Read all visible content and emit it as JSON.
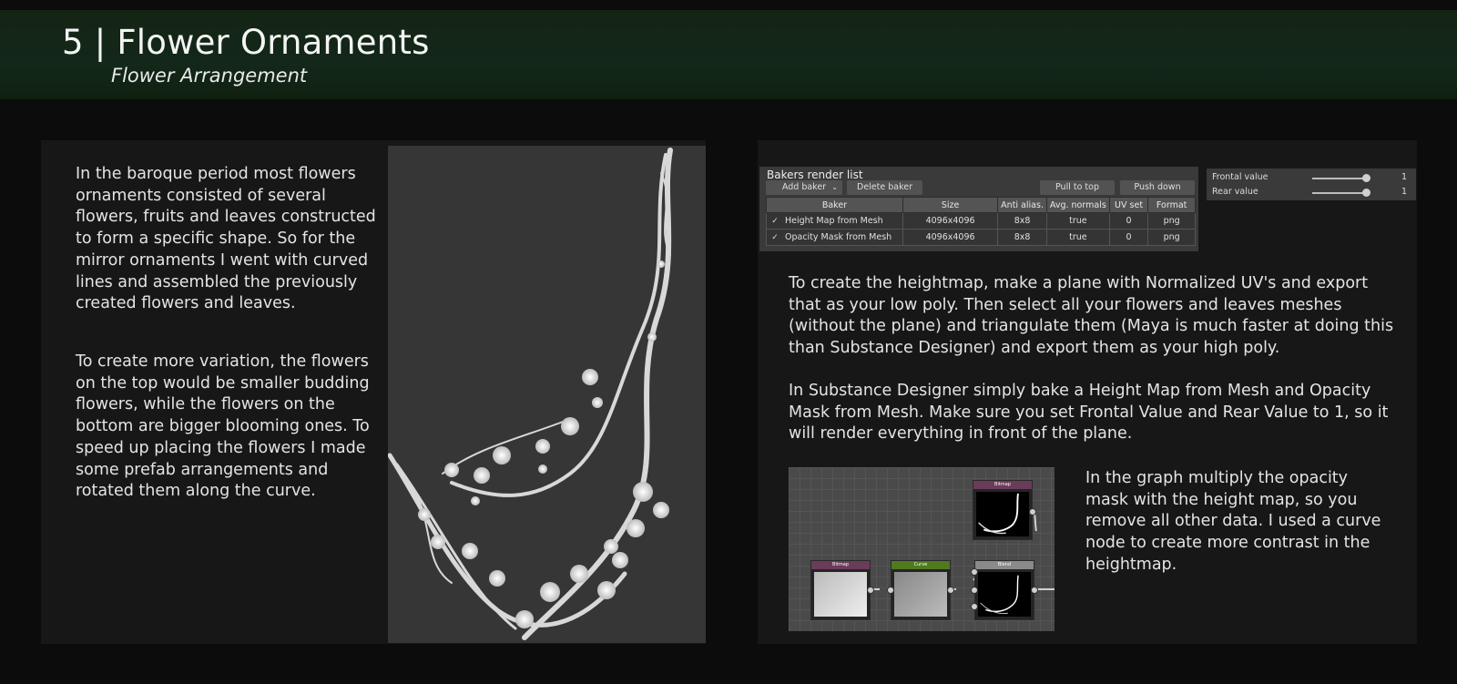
{
  "header": {
    "title": "5 | Flower Ornaments",
    "subtitle": "Flower Arrangement"
  },
  "left": {
    "paragraph1": "In the baroque period most flowers ornaments consisted of several flowers, fruits and leaves constructed to form a specific shape. So for the mirror ornaments I went with curved lines and assembled the previously created flowers and leaves.",
    "paragraph2": "To create more variation, the flowers on the top would be smaller budding flowers, while the flowers on the bottom are bigger blooming ones. To speed up placing the flowers I made some prefab arrangements and rotated them along the curve."
  },
  "bakers": {
    "title": "Bakers render list",
    "add_label": "Add baker",
    "delete_label": "Delete baker",
    "pull_label": "Pull to top",
    "push_label": "Push down",
    "columns": [
      "Baker",
      "Size",
      "Anti alias.",
      "Avg. normals",
      "UV set",
      "Format"
    ],
    "rows": [
      {
        "name": "Height Map from Mesh",
        "size": "4096x4096",
        "aa": "8x8",
        "avg": "true",
        "uv": "0",
        "format": "png"
      },
      {
        "name": "Opacity Mask from Mesh",
        "size": "4096x4096",
        "aa": "8x8",
        "avg": "true",
        "uv": "0",
        "format": "png"
      }
    ]
  },
  "values": {
    "frontal_label": "Frontal value",
    "frontal_value": "1",
    "rear_label": "Rear value",
    "rear_value": "1"
  },
  "right": {
    "paragraph1": "To create the heightmap, make a plane with Normalized UV's and export that as your low poly. Then select all your flowers and leaves meshes (without the plane) and triangulate them (Maya is much faster at doing this than Substance Designer) and export them as your high poly.",
    "paragraph2": "In Substance Designer simply bake a Height Map from Mesh and Opacity Mask from Mesh. Make sure you set Frontal Value and Rear Value to 1, so it will render everything in front of the plane.",
    "paragraph3": "In the graph multiply the opacity mask with the height map, so you remove all other data. I used a curve node to create more contrast in the heightmap."
  },
  "graph": {
    "nodes": {
      "bitmap_top": "Bitmap",
      "bitmap_left": "Bitmap",
      "curve": "Curve",
      "blend": "Blend"
    }
  },
  "colors": {
    "header_green": "#13281a",
    "panel_bg": "#171717",
    "node_bitmap": "#6b3b5a",
    "node_curve": "#4f7a1e",
    "node_blend": "#8a8a8a"
  }
}
